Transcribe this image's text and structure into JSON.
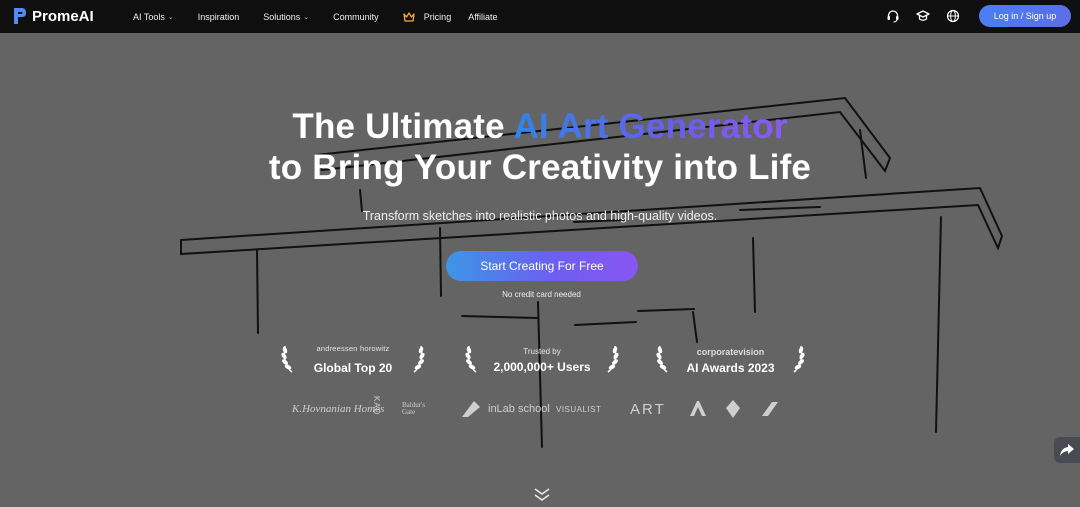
{
  "nav": {
    "logo_text": "PromeAI",
    "items": [
      {
        "label": "AI Tools",
        "has_dropdown": true
      },
      {
        "label": "Inspiration",
        "has_dropdown": false
      },
      {
        "label": "Solutions",
        "has_dropdown": true
      },
      {
        "label": "Community",
        "has_dropdown": false
      }
    ],
    "pricing_label": "Pricing",
    "affiliate_label": "Affiliate",
    "icons": [
      "headset-icon",
      "graduation-cap-icon",
      "globe-icon"
    ],
    "login_label": "Log in / Sign up",
    "accent_color": "#5470ec"
  },
  "hero": {
    "title_prefix": "The Ultimate ",
    "title_highlight": "AI Art Generator",
    "title_line2": "to Bring Your Creativity into Life",
    "subtitle": "Transform sketches into realistic photos and high-quality videos.",
    "cta_label": "Start Creating For Free",
    "cta_note": "No credit card needed"
  },
  "awards": [
    {
      "small": "andreessen horowitz",
      "big": "Global Top 20"
    },
    {
      "small": "Trusted by",
      "big": "2,000,000+ Users"
    },
    {
      "small": "corporatevision",
      "big": "AI Awards 2023"
    }
  ],
  "brands": [
    "K.Hovnanian Homes",
    "KAD",
    "Baldur's Gate",
    "inLab school",
    "VISUALIST",
    "ART"
  ],
  "share_icon": "share-icon",
  "scroll_icon": "double-chevron-down-icon"
}
